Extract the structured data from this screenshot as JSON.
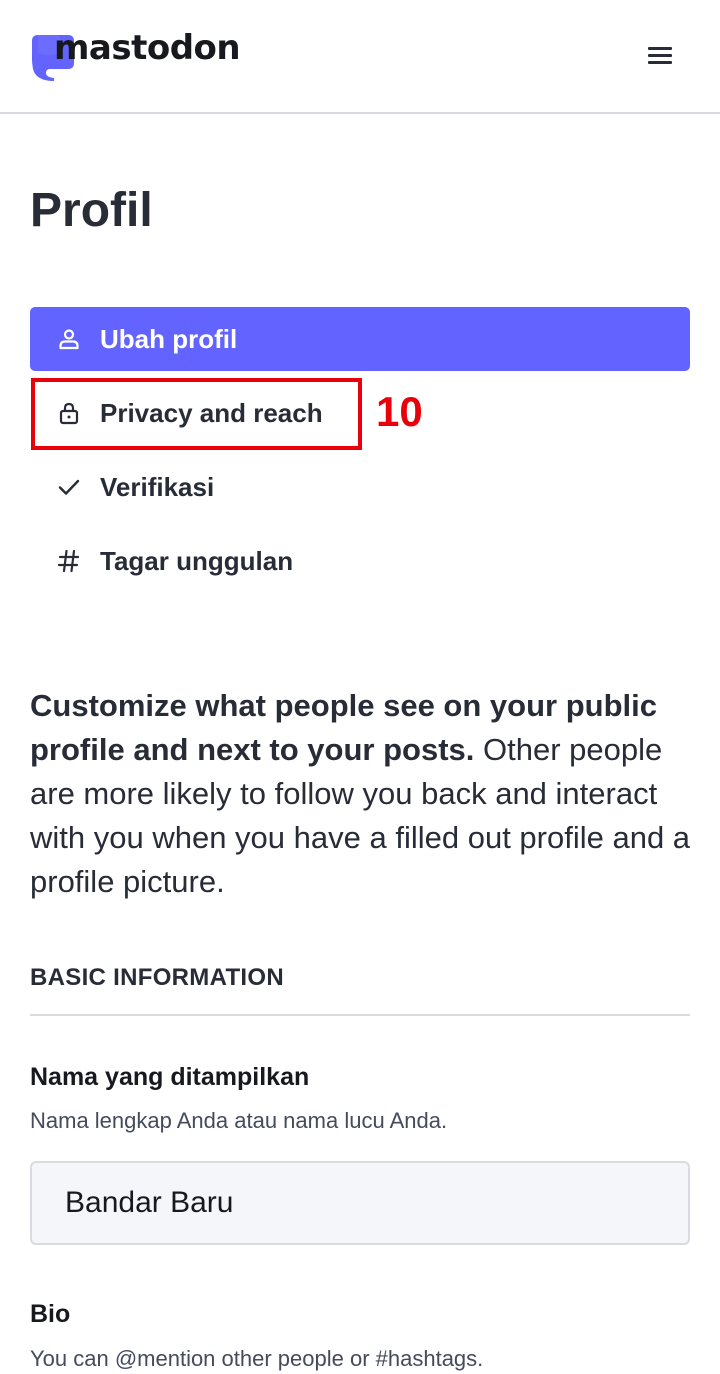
{
  "header": {
    "logo_text": "mastodon",
    "logo_icon": "mastodon-logo-icon",
    "menu_icon": "hamburger-menu-icon",
    "brand_color": "#6364ff"
  },
  "page": {
    "title": "Profil"
  },
  "nav": {
    "items": [
      {
        "label": "Ubah profil",
        "icon": "person-icon",
        "active": true
      },
      {
        "label": "Privacy and reach",
        "icon": "lock-icon",
        "active": false
      },
      {
        "label": "Verifikasi",
        "icon": "check-icon",
        "active": false
      },
      {
        "label": "Tagar unggulan",
        "icon": "hashtag-icon",
        "active": false
      }
    ]
  },
  "annotation": {
    "number": "10",
    "color": "#e8000b"
  },
  "intro": {
    "bold": "Customize what people see on your public profile and next to your posts.",
    "rest": " Other people are more likely to follow you back and interact with you when you have a filled out profile and a profile picture."
  },
  "basic_info": {
    "section_title": "BASIC INFORMATION",
    "display_name": {
      "label": "Nama yang ditampilkan",
      "hint": "Nama lengkap Anda atau nama lucu Anda.",
      "value": "Bandar Baru"
    },
    "bio": {
      "label": "Bio",
      "hint": "You can @mention other people or #hashtags."
    }
  }
}
